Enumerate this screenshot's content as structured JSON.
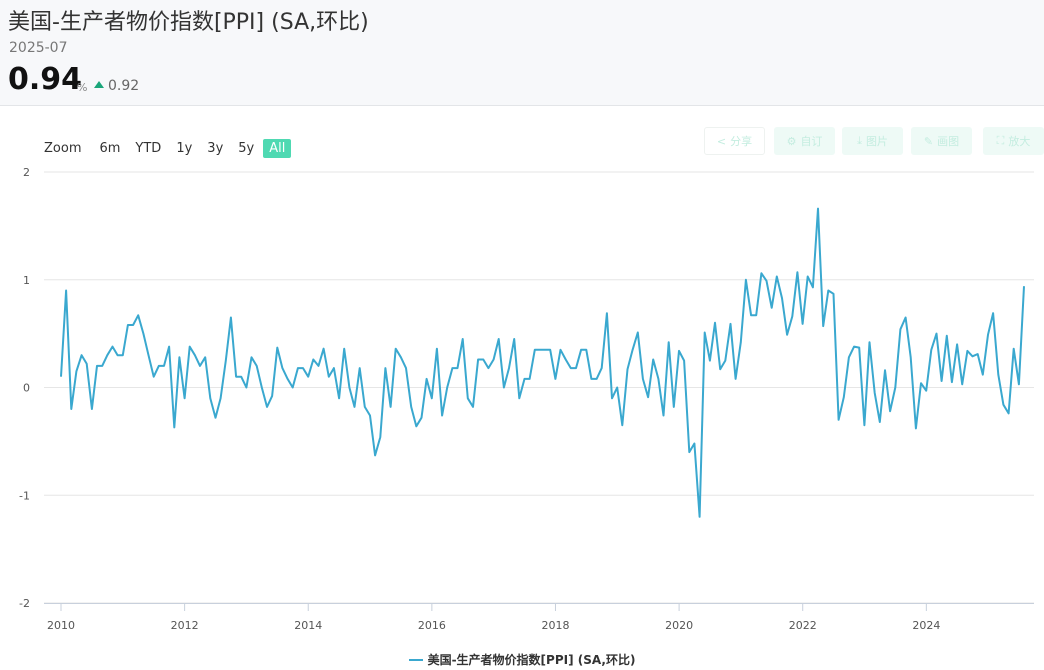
{
  "header": {
    "title": "美国-生产者物价指数[PPI] (SA,环比)",
    "date": "2025-07",
    "value": "0.94",
    "unit": "%",
    "previous": "0.92"
  },
  "range_selector": {
    "zoom_label": "Zoom",
    "buttons": [
      "6m",
      "YTD",
      "1y",
      "3y",
      "5y",
      "All"
    ],
    "active": "All"
  },
  "toolbar": {
    "share": "分享",
    "subscribe": "自订",
    "image": "图片",
    "draw": "画图",
    "fullscreen": "放大"
  },
  "colors": {
    "series": "#3aa8cf",
    "active_button": "#4fd9b2",
    "up": "#1aa67a"
  },
  "chart_data": {
    "type": "line",
    "title": "美国-生产者物价指数[PPI] (SA,环比)",
    "xlabel": "",
    "ylabel": "",
    "xlim": [
      2010.0,
      2025.58
    ],
    "ylim": [
      -2,
      2
    ],
    "x_ticks": [
      "2010",
      "2012",
      "2014",
      "2016",
      "2018",
      "2020",
      "2022",
      "2024"
    ],
    "y_ticks": [
      "2",
      "1",
      "0",
      "-1",
      "-2"
    ],
    "grid": true,
    "legend": "bottom-center",
    "x_start": "2010-01",
    "frequency": "monthly",
    "series": [
      {
        "name": "美国-生产者物价指数[PPI] (SA,环比)",
        "values": [
          0.1,
          0.9,
          -0.2,
          0.15,
          0.3,
          0.22,
          -0.2,
          0.2,
          0.2,
          0.3,
          0.38,
          0.3,
          0.3,
          0.58,
          0.58,
          0.67,
          0.5,
          0.3,
          0.1,
          0.2,
          0.2,
          0.38,
          -0.37,
          0.28,
          -0.1,
          0.38,
          0.3,
          0.2,
          0.28,
          -0.1,
          -0.28,
          -0.1,
          0.25,
          0.65,
          0.1,
          0.1,
          0.0,
          0.28,
          0.2,
          0.0,
          -0.18,
          -0.08,
          0.37,
          0.18,
          0.08,
          0.0,
          0.18,
          0.18,
          0.1,
          0.26,
          0.2,
          0.36,
          0.1,
          0.18,
          -0.1,
          0.36,
          0.0,
          -0.18,
          0.18,
          -0.18,
          -0.26,
          -0.63,
          -0.46,
          0.18,
          -0.18,
          0.36,
          0.28,
          0.18,
          -0.18,
          -0.36,
          -0.28,
          0.08,
          -0.1,
          0.36,
          -0.26,
          0.0,
          0.18,
          0.18,
          0.45,
          -0.1,
          -0.18,
          0.26,
          0.26,
          0.18,
          0.26,
          0.45,
          0.0,
          0.18,
          0.45,
          -0.1,
          0.08,
          0.08,
          0.35,
          0.35,
          0.35,
          0.35,
          0.08,
          0.35,
          0.26,
          0.18,
          0.18,
          0.35,
          0.35,
          0.08,
          0.08,
          0.18,
          0.69,
          -0.1,
          0.0,
          -0.35,
          0.17,
          0.35,
          0.51,
          0.08,
          -0.09,
          0.26,
          0.08,
          -0.26,
          0.42,
          -0.18,
          0.34,
          0.25,
          -0.6,
          -0.52,
          -1.2,
          0.51,
          0.25,
          0.6,
          0.17,
          0.25,
          0.59,
          0.08,
          0.42,
          1.0,
          0.67,
          0.67,
          1.06,
          0.99,
          0.74,
          1.03,
          0.83,
          0.49,
          0.66,
          1.07,
          0.59,
          1.03,
          0.93,
          1.66,
          0.57,
          0.9,
          0.87,
          -0.3,
          -0.09,
          0.28,
          0.38,
          0.37,
          -0.35,
          0.42,
          -0.05,
          -0.32,
          0.16,
          -0.22,
          0.0,
          0.54,
          0.65,
          0.28,
          -0.38,
          0.04,
          -0.03,
          0.35,
          0.5,
          0.06,
          0.48,
          0.05,
          0.4,
          0.03,
          0.34,
          0.29,
          0.31,
          0.12,
          0.49,
          0.69,
          0.12,
          -0.16,
          -0.24,
          0.36,
          0.03,
          0.94
        ]
      }
    ]
  }
}
